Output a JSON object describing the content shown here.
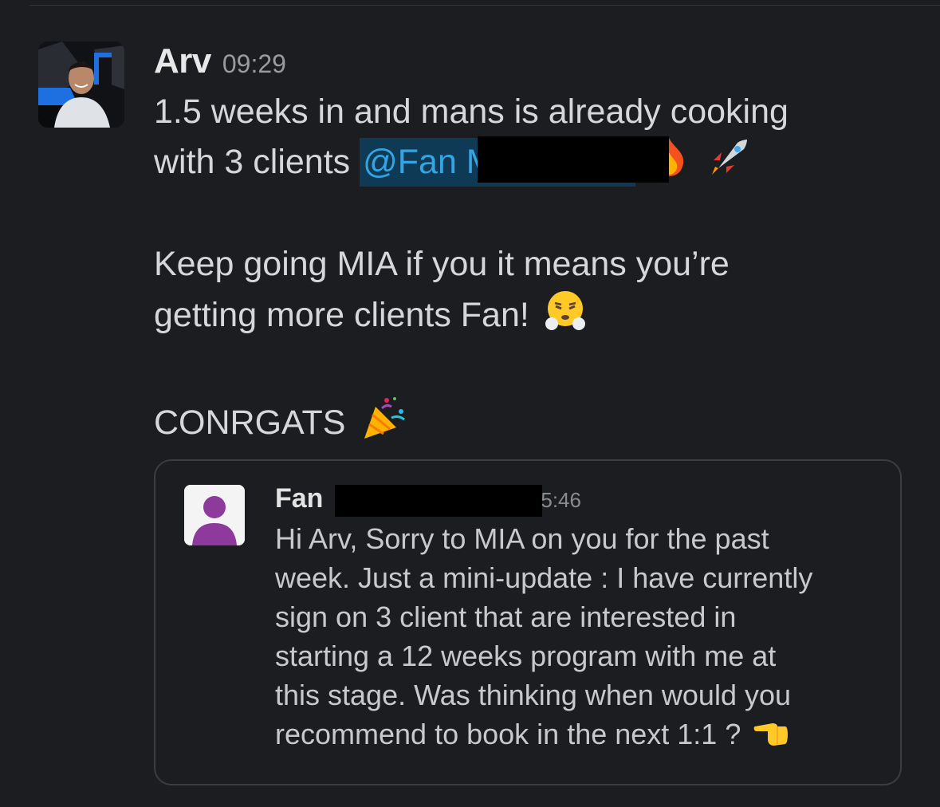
{
  "message": {
    "author": "Arv",
    "time": "09:29",
    "lines": [
      "1.5 weeks in and mans is already cooking",
      "with 3 clients ",
      "Keep going MIA if you it means you’re",
      "getting more clients Fan!",
      "CONRGATS"
    ],
    "mention": "@Fan Ming Chan",
    "emojis": [
      "fire-emoji",
      "rocket-emoji",
      "steam-face-emoji",
      "party-popper-emoji"
    ]
  },
  "quote": {
    "author": "Fan",
    "time_fragment": "15:46",
    "lines": [
      "Hi Arv, Sorry to MIA on you for the past",
      "week. Just a mini-update : I have currently",
      "sign on 3 client that are interested in",
      "starting a 12 weeks program with me at",
      "this stage. Was thinking when would you",
      "recommend to book in the next 1:1 ?"
    ],
    "emoji": "pointing-hand-emoji"
  },
  "colors": {
    "background": "#1b1d21",
    "mention_bg": "#0f3a55",
    "mention_text": "#36a4e1",
    "quote_border": "#3b3d42",
    "default_avatar": "#8e3a9d"
  }
}
